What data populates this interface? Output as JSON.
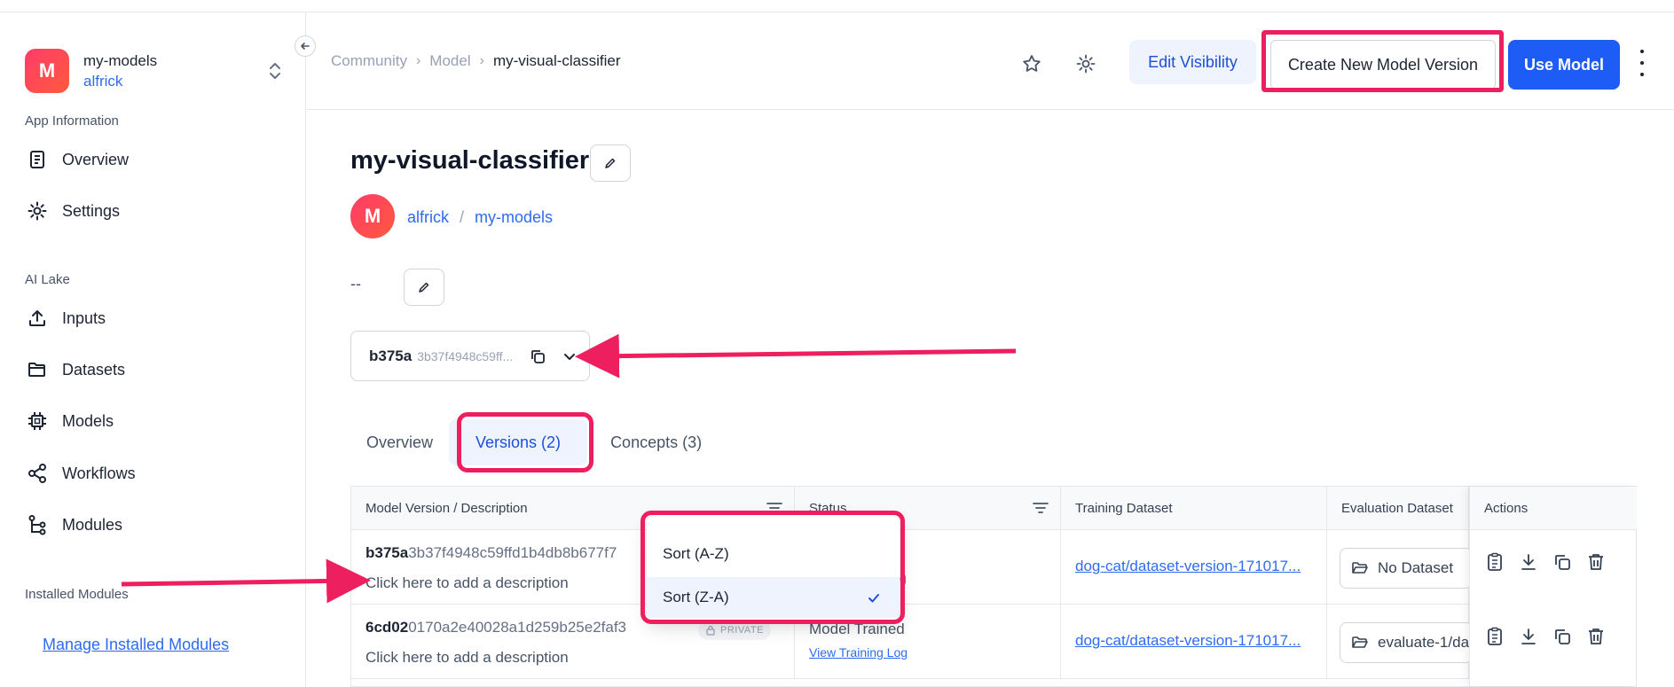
{
  "sidebar": {
    "app_avatar_letter": "M",
    "app_name": "my-models",
    "app_user": "alfrick",
    "app_info_label": "App Information",
    "nav_top": [
      {
        "label": "Overview",
        "icon": "document-icon"
      },
      {
        "label": "Settings",
        "icon": "gear-icon"
      }
    ],
    "ai_lake_label": "AI Lake",
    "nav_lake": [
      {
        "label": "Inputs",
        "icon": "upload-icon"
      },
      {
        "label": "Datasets",
        "icon": "folder-icon"
      },
      {
        "label": "Models",
        "icon": "chip-icon"
      },
      {
        "label": "Workflows",
        "icon": "share-icon"
      },
      {
        "label": "Modules",
        "icon": "modules-icon"
      }
    ],
    "installed_label": "Installed Modules",
    "manage_link": "Manage Installed Modules"
  },
  "header": {
    "breadcrumb": [
      "Community",
      "Model",
      "my-visual-classifier"
    ],
    "edit_visibility": "Edit Visibility",
    "create_version": "Create New Model Version",
    "use_model": "Use Model"
  },
  "model": {
    "title": "my-visual-classifier",
    "owner_avatar_letter": "M",
    "owner": "alfrick",
    "app": "my-models",
    "description": "--",
    "version_short": "b375a",
    "version_hash_trunc": "3b37f4948c59ff..."
  },
  "tabs": [
    "Overview",
    "Versions (2)",
    "Concepts (3)"
  ],
  "table": {
    "headers": [
      "Model Version / Description",
      "Status",
      "Training Dataset",
      "Evaluation Dataset",
      "Actions"
    ],
    "rows": [
      {
        "id_bold": "b375a",
        "id_rest": "3b37f4948c59ffd1b4db8b677f7",
        "description": "Click here to add a description",
        "badge": "",
        "status": "",
        "status_link": "g",
        "training_dataset": "dog-cat/dataset-version-171017...",
        "evaluation_dataset": "No Dataset"
      },
      {
        "id_bold": "6cd02",
        "id_rest": "0170a2e40028a1d259b25e2faf3",
        "description": "Click here to add a description",
        "badge": "PRIVATE",
        "status": "Model Trained",
        "status_link": "View Training Log",
        "training_dataset": "dog-cat/dataset-version-171017...",
        "evaluation_dataset": "evaluate-1/da"
      }
    ]
  },
  "sort_menu": {
    "options": [
      "Sort (A-Z)",
      "Sort (Z-A)"
    ],
    "selected": "Sort (Z-A)"
  },
  "colors": {
    "accent": "#1d5cf5",
    "highlight": "#ee1f5f",
    "link": "#2f6bf0"
  }
}
